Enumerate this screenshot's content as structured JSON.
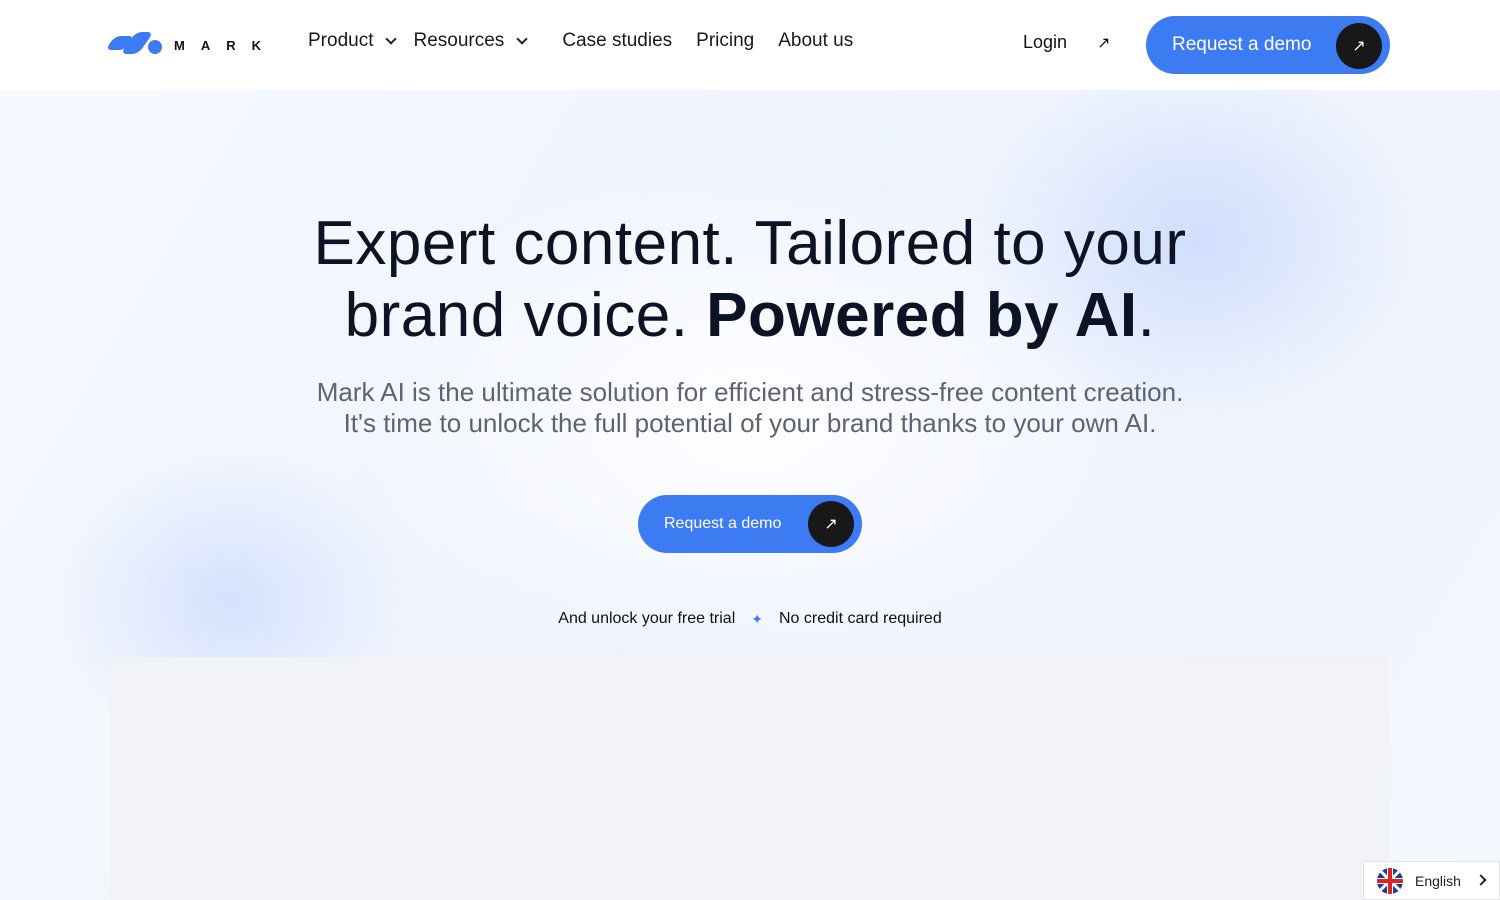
{
  "brand": {
    "name": "MARK",
    "accent": "#3d7bf2"
  },
  "nav": {
    "items": [
      {
        "label": "Product",
        "has_dropdown": true
      },
      {
        "label": "Resources",
        "has_dropdown": true
      },
      {
        "label": "Case studies",
        "has_dropdown": false
      },
      {
        "label": "Pricing",
        "has_dropdown": false
      },
      {
        "label": "About us",
        "has_dropdown": false
      }
    ],
    "login_label": "Login",
    "login_icon": "arrow-up-right-icon",
    "cta_label": "Request a demo",
    "cta_icon": "arrow-up-right-icon"
  },
  "hero": {
    "title_line1": "Expert content. Tailored to your",
    "title_line2_regular": "brand voice. ",
    "title_line2_bold": "Powered by AI",
    "title_line2_end": ".",
    "subtitle_line1": "Mark AI is the ultimate solution for efficient and stress-free content creation.",
    "subtitle_line2": "It's time to unlock the full potential of your brand thanks to your own AI.",
    "cta_label": "Request a demo",
    "trial_text": "And unlock your free trial",
    "separator_icon": "sparkle-icon",
    "no_card_text": "No credit card required"
  },
  "language": {
    "label": "English",
    "flag": "uk-flag-icon"
  }
}
